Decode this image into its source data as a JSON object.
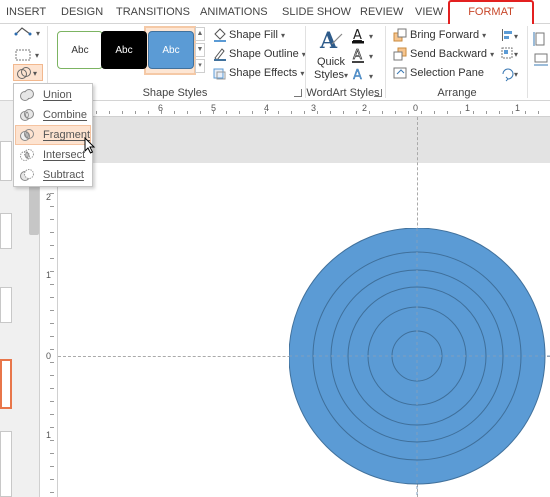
{
  "tabs": [
    {
      "label": "INSERT"
    },
    {
      "label": "DESIGN"
    },
    {
      "label": "TRANSITIONS"
    },
    {
      "label": "ANIMATIONS"
    },
    {
      "label": "SLIDE SHOW"
    },
    {
      "label": "REVIEW"
    },
    {
      "label": "VIEW"
    },
    {
      "label": "FORMAT",
      "active": true
    }
  ],
  "ribbon": {
    "shape_styles": {
      "thumbs": [
        "Abc",
        "Abc",
        "Abc"
      ],
      "group_label": "Shape Styles"
    },
    "shape_fill_label": "Shape Fill",
    "shape_outline_label": "Shape Outline",
    "shape_effects_label": "Shape Effects",
    "quick_styles_label_1": "Quick",
    "quick_styles_label_2": "Styles",
    "wordart_group_label": "WordArt Styles",
    "bring_forward_label": "Bring Forward",
    "send_backward_label": "Send Backward",
    "selection_pane_label": "Selection Pane",
    "arrange_group_label": "Arrange"
  },
  "merge_shapes_menu": {
    "items": [
      {
        "label": "Union",
        "icon": "union-icon"
      },
      {
        "label": "Combine",
        "icon": "combine-icon"
      },
      {
        "label": "Fragment",
        "icon": "fragment-icon",
        "hovered": true
      },
      {
        "label": "Intersect",
        "icon": "intersect-icon"
      },
      {
        "label": "Subtract",
        "icon": "subtract-icon"
      }
    ]
  },
  "ruler": {
    "h_numbers": [
      "6",
      "5",
      "4",
      "3",
      "2",
      "1",
      "0",
      "1"
    ],
    "v_numbers": [
      "3",
      "2",
      "1",
      "0",
      "1"
    ]
  },
  "colors": {
    "accent": "#c8472a",
    "format_highlight": "#e32020",
    "shape_fill": "#5b9bd5",
    "shape_outline": "#41719c",
    "menu_hover": "#fde3d0"
  }
}
